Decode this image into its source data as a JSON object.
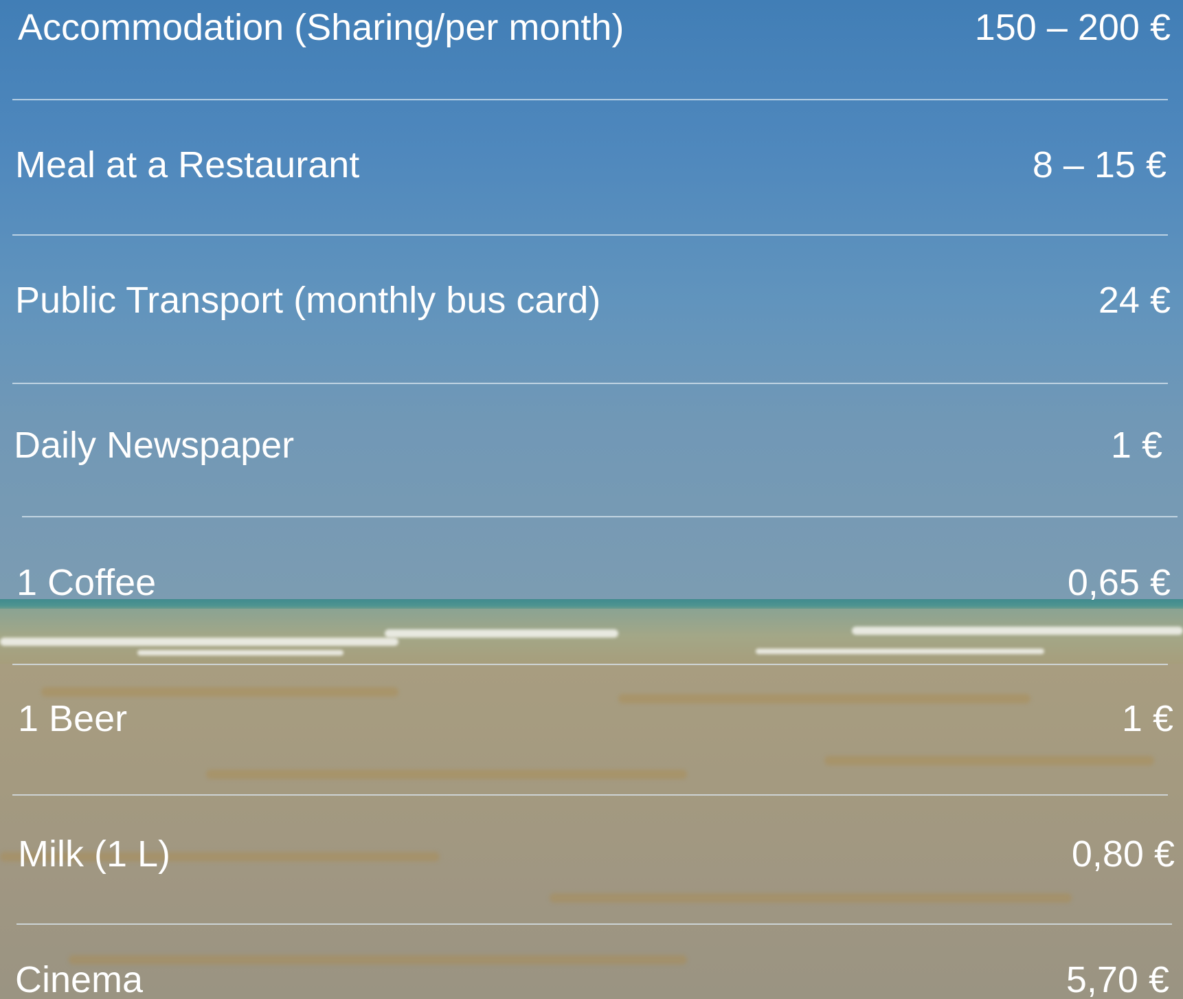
{
  "items": [
    {
      "label": "Accommodation (Sharing/per month)",
      "price": "150 – 200 €"
    },
    {
      "label": "Meal at a Restaurant",
      "price": "8 – 15 €"
    },
    {
      "label": "Public Transport (monthly bus card)",
      "price": "24 €"
    },
    {
      "label": "Daily Newspaper",
      "price": "1 €"
    },
    {
      "label": "1 Coffee",
      "price": "0,65 €"
    },
    {
      "label": "1 Beer",
      "price": "1 €"
    },
    {
      "label": "Milk (1 L)",
      "price": "0,80 €"
    },
    {
      "label": "Cinema",
      "price": "5,70 €"
    }
  ]
}
